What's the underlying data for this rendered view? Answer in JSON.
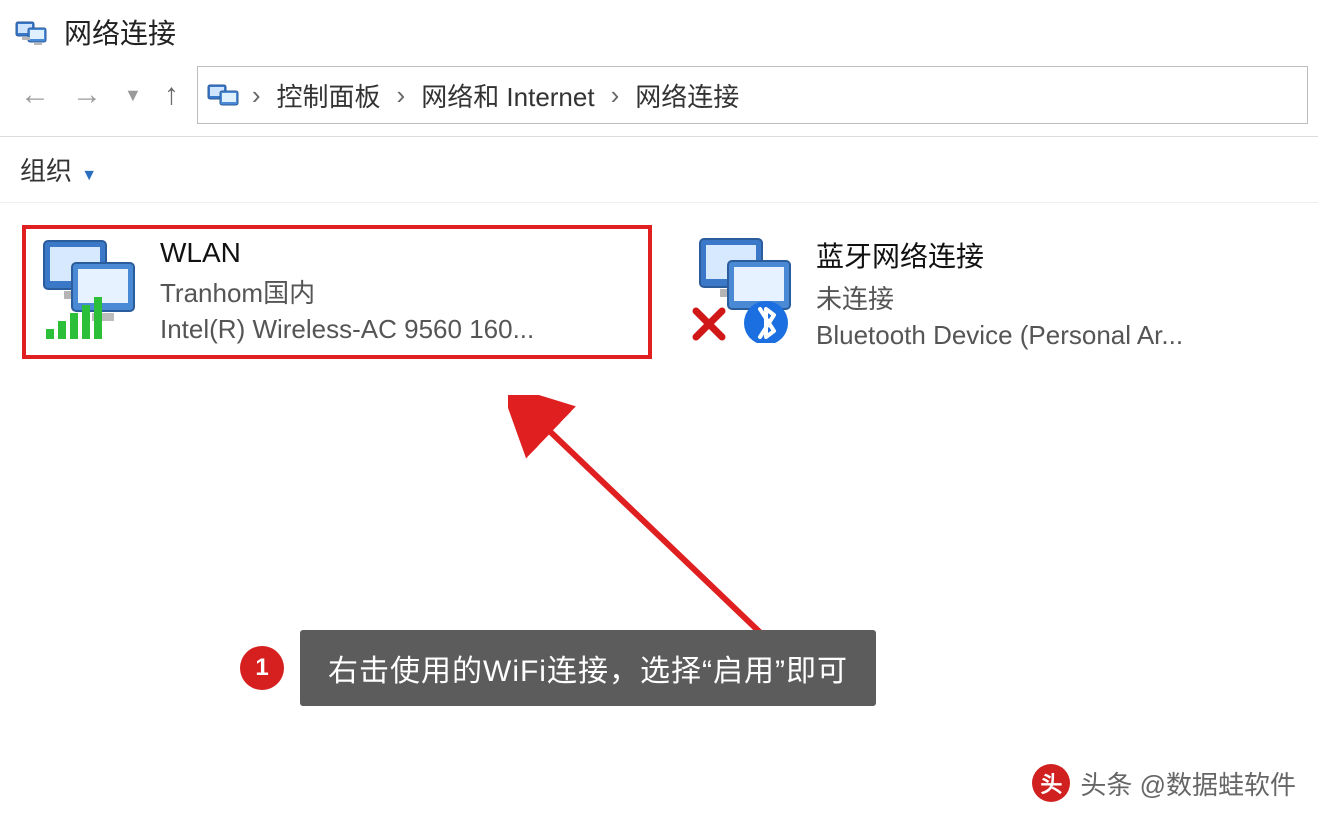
{
  "window": {
    "title": "网络连接"
  },
  "nav": {
    "breadcrumbs": [
      "控制面板",
      "网络和 Internet",
      "网络连接"
    ]
  },
  "toolbar": {
    "organize": "组织"
  },
  "connections": {
    "wlan": {
      "name": "WLAN",
      "network": "Tranhom国内",
      "adapter": "Intel(R) Wireless-AC 9560 160..."
    },
    "bluetooth": {
      "name": "蓝牙网络连接",
      "status": "未连接",
      "adapter": "Bluetooth Device (Personal Ar..."
    }
  },
  "annotation": {
    "step": "1",
    "text": "右击使用的WiFi连接，选择“启用”即可"
  },
  "watermark": {
    "text": "头条 @数据蛙软件"
  }
}
